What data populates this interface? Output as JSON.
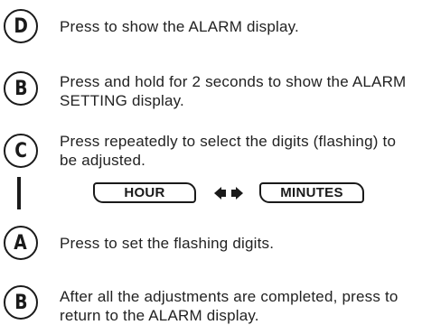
{
  "steps": [
    {
      "button": "D",
      "text": "Press to show the ALARM display."
    },
    {
      "button": "B",
      "text": "Press and hold for 2 seconds to show the ALARM SETTING display."
    },
    {
      "button": "C",
      "text": "Press repeatedly to select the digits (flashing) to be adjusted."
    },
    {
      "button": "A",
      "text": "Press to set the flashing digits."
    },
    {
      "button": "B",
      "text": "After all the adjustments are completed, press to return to the ALARM display."
    }
  ],
  "cycle": {
    "left_label": "HOUR",
    "right_label": "MINUTES",
    "arrows_icon": "bidirectional-arrows-icon"
  }
}
